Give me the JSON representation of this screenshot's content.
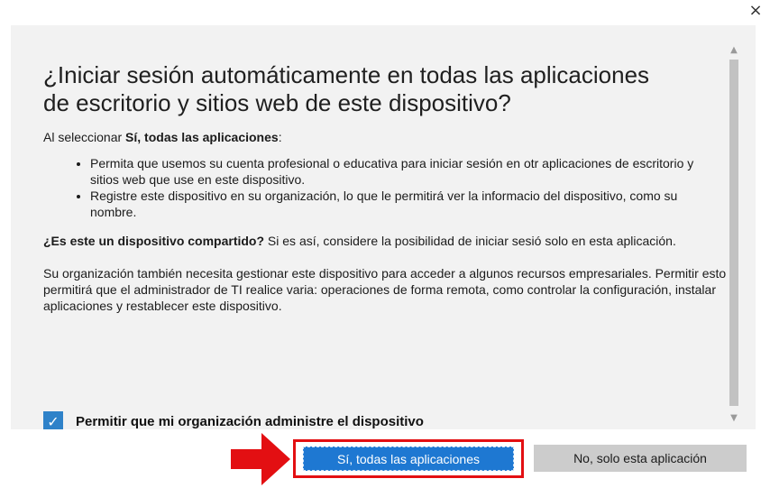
{
  "dialog": {
    "close_glyph": "×",
    "title": "¿Iniciar sesión automáticamente en todas las aplicaciones de escritorio y sitios web de este dispositivo?",
    "intro_prefix": "Al seleccionar ",
    "intro_bold": "Sí, todas las aplicaciones",
    "intro_suffix": ":",
    "bullets": [
      "Permita que usemos su cuenta profesional o educativa para iniciar sesión en otr aplicaciones de escritorio y sitios web que use en este dispositivo.",
      "Registre este dispositivo en su organización, lo que le permitirá ver la informacio del dispositivo, como su nombre."
    ],
    "shared_bold": "¿Es este un dispositivo compartido?",
    "shared_text": " Si es así, considere la posibilidad de iniciar sesió solo en esta aplicación.",
    "org_text": "Su organización también necesita gestionar este dispositivo para acceder a algunos recursos empresariales. Permitir esto permitirá que el administrador de TI realice varia: operaciones de forma remota, como controlar la configuración, instalar aplicaciones y restablecer este dispositivo.",
    "checkbox_label": "Permitir que mi organización administre el dispositivo",
    "checkbox_checked": true
  },
  "buttons": {
    "primary_label": "Sí, todas las aplicaciones",
    "secondary_label": "No, solo esta aplicación"
  },
  "colors": {
    "primary_button": "#1e78d2",
    "highlight_border": "#e30f12",
    "arrow": "#e30f12",
    "checkbox": "#2f82c9"
  },
  "icons": {
    "close": "close-icon",
    "checkmark": "checkmark-icon",
    "arrow": "arrow-right-icon"
  }
}
